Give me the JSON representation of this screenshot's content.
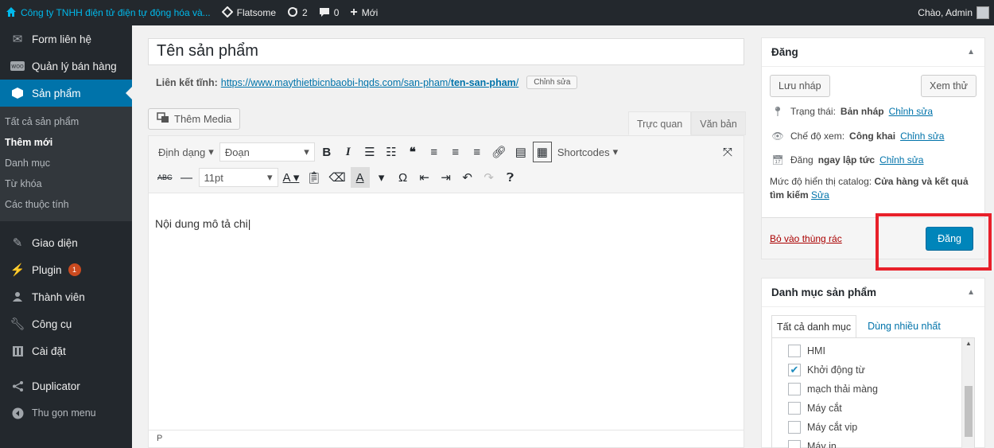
{
  "adminbar": {
    "site_name": "Công ty TNHH điện tử điện tự động hóa và...",
    "theme": "Flatsome",
    "updates": "2",
    "comments": "0",
    "new_label": "Mới",
    "greeting": "Chào, Admin"
  },
  "sidebar": {
    "items_top": [
      {
        "label": "Form liên hệ",
        "icon": "mail-icon"
      },
      {
        "label": "Quản lý bán hàng",
        "icon": "woo-icon"
      },
      {
        "label": "Sản phẩm",
        "icon": "product-icon"
      }
    ],
    "submenu": [
      {
        "label": "Tất cả sản phẩm"
      },
      {
        "label": "Thêm mới"
      },
      {
        "label": "Danh mục"
      },
      {
        "label": "Từ khóa"
      },
      {
        "label": "Các thuộc tính"
      }
    ],
    "items_bottom": [
      {
        "label": "Giao diện",
        "icon": "brush-icon"
      },
      {
        "label": "Plugin",
        "icon": "plugin-icon",
        "badge": "1"
      },
      {
        "label": "Thành viên",
        "icon": "users-icon"
      },
      {
        "label": "Công cụ",
        "icon": "wrench-icon"
      },
      {
        "label": "Cài đặt",
        "icon": "settings-icon"
      },
      {
        "label": "Duplicator",
        "icon": "share-icon"
      },
      {
        "label": "Thu gọn menu",
        "icon": "collapse-icon"
      }
    ]
  },
  "editor": {
    "title_value": "Tên sản phẩm",
    "permalink_label": "Liên kết tĩnh:",
    "permalink_base": "https://www.maythietbicnbaobi-hqds.com/san-pham/",
    "permalink_slug": "ten-san-pham",
    "permalink_end": "/",
    "edit_slug_label": "Chỉnh sửa",
    "add_media_label": "Thêm Media",
    "tab_visual": "Trực quan",
    "tab_text": "Văn bản",
    "format_label": "Định dạng",
    "paragraph_select": "Đoạn",
    "shortcodes_label": "Shortcodes",
    "font_size": "11pt",
    "content_text": "Nội dung mô tả chi",
    "status_path": "P"
  },
  "publish": {
    "title": "Đăng",
    "save_draft": "Lưu nháp",
    "preview": "Xem thử",
    "status_label": "Trạng thái:",
    "status_value": "Bản nháp",
    "visibility_label": "Chế độ xem:",
    "visibility_value": "Công khai",
    "publish_label": "Đăng",
    "publish_value": "ngay lập tức",
    "edit_link": "Chỉnh sửa",
    "catalog_label": "Mức độ hiển thị catalog:",
    "catalog_value": "Cửa hàng và kết quả tìm kiếm",
    "catalog_edit": "Sửa",
    "trash_link": "Bỏ vào thùng rác",
    "publish_button": "Đăng"
  },
  "categories": {
    "title": "Danh mục sản phẩm",
    "tab_all": "Tất cả danh mục",
    "tab_popular": "Dùng nhiều nhất",
    "items": [
      {
        "label": "HMI",
        "checked": false
      },
      {
        "label": "Khởi động từ",
        "checked": true
      },
      {
        "label": "mạch thải màng",
        "checked": false
      },
      {
        "label": "Máy cắt",
        "checked": false
      },
      {
        "label": "Máy cắt vip",
        "checked": false
      },
      {
        "label": "Máy in",
        "checked": false
      }
    ]
  },
  "colors": {
    "admin_dark": "#23282d",
    "accent_blue": "#0073aa",
    "primary_button": "#0085ba",
    "highlight_red": "#e8202a",
    "badge_orange": "#ca4a1f"
  }
}
